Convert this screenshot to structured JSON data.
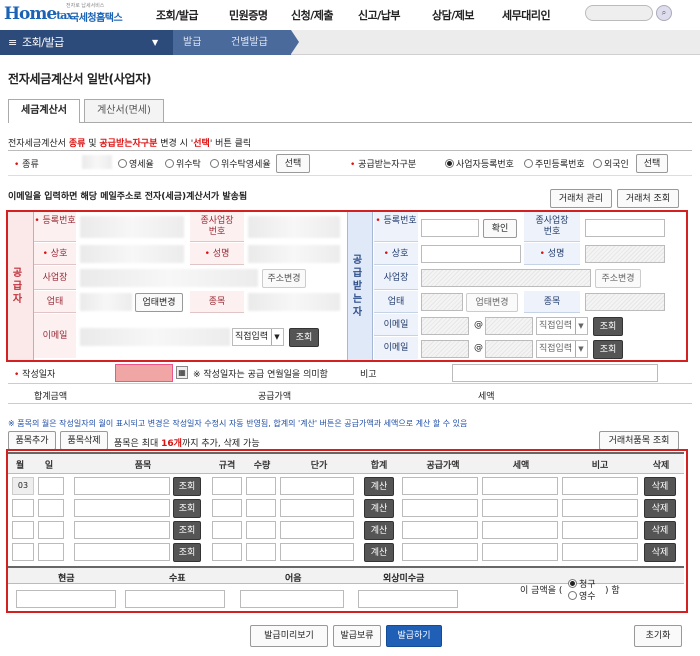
{
  "header": {
    "logo_main": "Home",
    "logo_tax": "tax",
    "logo_sub": "국세청홈택스",
    "logo_tiny": "전자로 납세서비스",
    "nav": [
      "조회/발급",
      "민원증명",
      "신청/제출",
      "신고/납부",
      "상담/제보",
      "세무대리인"
    ]
  },
  "breadcrumb": {
    "main": "조회/발급",
    "level1": "발급",
    "level2": "건별발급"
  },
  "page_title": "전자세금계산서 일반(사업자)",
  "tabs": [
    "세금계산서",
    "계산서(면세)"
  ],
  "notice1_parts": [
    "전자세금계산서 ",
    "종류",
    " 및 ",
    "공급받는자구분",
    " 변경 시 '",
    "선택",
    "' 버튼 클릭"
  ],
  "kind": {
    "label": "종류",
    "options": [
      "영세율",
      "위수탁",
      "위수탁영세율"
    ],
    "select_button": "선택"
  },
  "receiver_type": {
    "label": "공급받는자구분",
    "options": [
      "사업자등록번호",
      "주민등록번호",
      "외국인"
    ],
    "selected": 0,
    "select_button": "선택"
  },
  "email_notice": "이메일을 입력하면 해당 메일주소로 전자(세금)계산서가 발송됨",
  "partner_buttons": [
    "거래처 관리",
    "거래처 조회"
  ],
  "supplier": {
    "section": "공급자",
    "reg_no": "등록번호",
    "branch": "종사업장\n번호",
    "name": "상호",
    "ceo": "성명",
    "address": "사업장",
    "addr_btn": "주소변경",
    "biz_type": "업태",
    "biz_type_btn": "업태변경",
    "item": "종목",
    "email": "이메일",
    "email_select": "직접입력",
    "lookup": "조회"
  },
  "receiver": {
    "section": "공급받는자",
    "reg_no": "등록번호",
    "confirm": "확인",
    "branch": "종사업장\n번호",
    "name": "상호",
    "ceo": "성명",
    "address": "사업장",
    "addr_btn": "주소변경",
    "biz_type": "업태",
    "biz_type_btn": "업태변경",
    "item": "종목",
    "email": "이메일",
    "at": "@",
    "email_select": "직접입력",
    "lookup": "조회"
  },
  "write_date": {
    "label": "작성일자",
    "note": "※ 작성일자는 공급 연월일을 의미함",
    "remark": "비고"
  },
  "totals": {
    "total": "합계금액",
    "supply": "공급가액",
    "tax": "세액"
  },
  "item_notice": "※ 품목의 월은 작성일자의 월이 표시되고 변경은 작성일자 수정시 자동 반영됨, 합계의 '계산' 버튼은 공급가액과 세액으로 계산 할 수 있음",
  "item_controls": {
    "add": "품목추가",
    "del": "품목삭제",
    "limit_pre": "품목은 최대 ",
    "limit_num": "16개",
    "limit_post": "까지 추가, 삭제 가능",
    "lookup": "거래처품목 조회"
  },
  "item_headers": [
    "월",
    "일",
    "품목",
    "규격",
    "수량",
    "단가",
    "합계",
    "공급가액",
    "세액",
    "비고",
    "삭제"
  ],
  "item_rows": [
    {
      "month": "03",
      "lookup": "조회",
      "calc": "계산",
      "del": "삭제"
    },
    {
      "month": "",
      "lookup": "조회",
      "calc": "계산",
      "del": "삭제"
    },
    {
      "month": "",
      "lookup": "조회",
      "calc": "계산",
      "del": "삭제"
    },
    {
      "month": "",
      "lookup": "조회",
      "calc": "계산",
      "del": "삭제"
    }
  ],
  "payment": {
    "headers": [
      "현금",
      "수표",
      "어음",
      "외상미수금"
    ],
    "prefix": "이 금액을 (",
    "options": [
      "청구",
      "영수"
    ],
    "suffix": ") 함"
  },
  "bottom_buttons": {
    "preview": "발급미리보기",
    "hold": "발급보류",
    "issue": "발급하기",
    "reset": "초기화"
  },
  "colors": {
    "accent_red": "#d32020",
    "navy": "#2c4a7a",
    "issue_blue": "#1f5fb5"
  }
}
